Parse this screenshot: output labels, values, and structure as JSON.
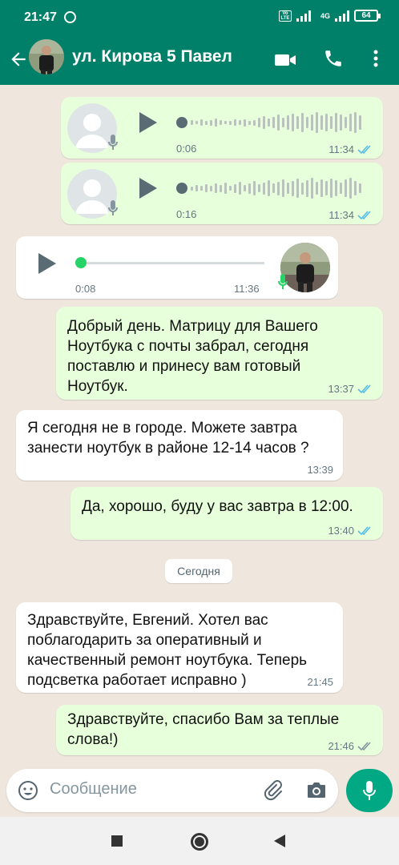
{
  "status_bar": {
    "time": "21:47",
    "network_tag": "4G",
    "volte_tag": "Vo LTE",
    "battery": "64"
  },
  "header": {
    "contact_name": "ул. Кирова 5 Павел",
    "icons": [
      "back-arrow-icon",
      "video-call-icon",
      "phone-icon",
      "more-icon"
    ]
  },
  "messages": [
    {
      "type": "voice",
      "direction": "out",
      "duration": "0:06",
      "time": "11:34",
      "status": "read"
    },
    {
      "type": "voice",
      "direction": "out",
      "duration": "0:16",
      "time": "11:34",
      "status": "read"
    },
    {
      "type": "voice",
      "direction": "in",
      "duration": "0:08",
      "time": "11:36"
    },
    {
      "type": "text",
      "direction": "out",
      "text": "Добрый день. Матрицу для Вашего Ноутбука с почты забрал, сегодня поставлю и принесу вам готовый Ноутбук.",
      "time": "13:37",
      "status": "read"
    },
    {
      "type": "text",
      "direction": "in",
      "text": "Я сегодня не в городе. Можете завтра занести ноутбук в районе 12-14 часов ?",
      "time": "13:39"
    },
    {
      "type": "text",
      "direction": "out",
      "text": "Да, хорошо, буду у вас завтра в 12:00.",
      "time": "13:40",
      "status": "read"
    },
    {
      "type": "text",
      "direction": "in",
      "text": "Здравствуйте, Евгений. Хотел вас поблагодарить за оперативный и качественный ремонт ноутбука. Теперь подсветка работает исправно )",
      "time": "21:45"
    },
    {
      "type": "text",
      "direction": "out",
      "text": "Здравствуйте, спасибо Вам за теплые слова!)",
      "time": "21:46",
      "status": "delivered"
    }
  ],
  "date_separator": "Сегодня",
  "composer": {
    "placeholder": "Сообщение"
  },
  "colors": {
    "header": "#008069",
    "outgoing_bubble": "#e7ffdb",
    "incoming_bubble": "#ffffff",
    "read_ticks": "#53bdeb",
    "accent": "#00a884"
  }
}
